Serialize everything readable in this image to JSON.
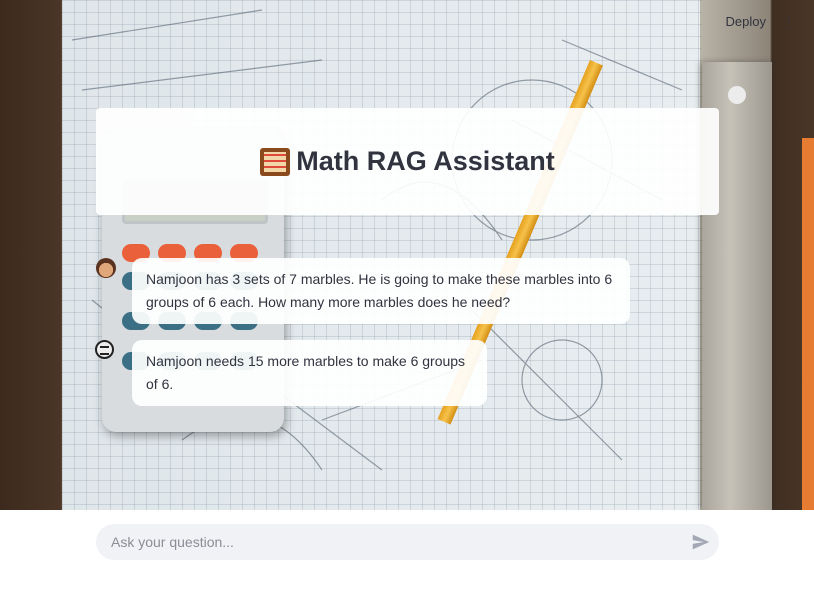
{
  "header": {
    "deploy_label": "Deploy",
    "menu_icon": "more-vertical-icon"
  },
  "title": {
    "icon": "abacus-icon",
    "text": "Math RAG Assistant"
  },
  "messages": [
    {
      "role": "user",
      "avatar_icon": "user-avatar-icon",
      "text": "Namjoon has 3 sets of 7 marbles. He is going to make these marbles into 6 groups of 6 each. How many more marbles does he need?"
    },
    {
      "role": "assistant",
      "avatar_icon": "assistant-avatar-icon",
      "text": "Namjoon needs 15 more marbles to make 6 groups of 6."
    }
  ],
  "chat_input": {
    "placeholder": "Ask your question...",
    "value": "",
    "send_icon": "send-icon"
  },
  "colors": {
    "text": "#31333f",
    "input_bg": "#f0f2f6",
    "pencil": "#f6c24a"
  }
}
